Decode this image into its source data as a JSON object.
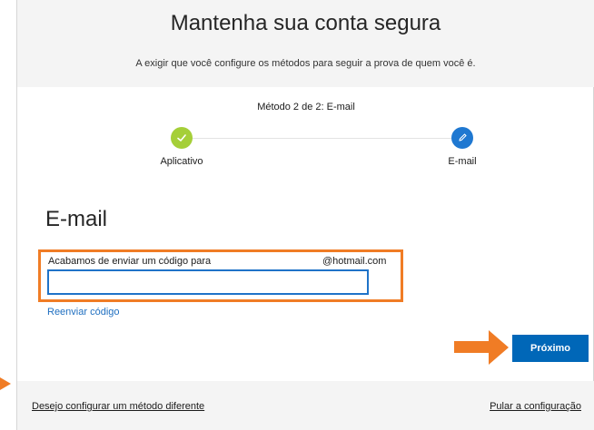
{
  "header": {
    "title": "Mantenha sua conta segura",
    "subtitle": "A exigir que você configure os métodos para seguir a prova de quem você é."
  },
  "progress": {
    "step_text": "Método 2 de 2: E-mail",
    "steps": [
      {
        "label": "Aplicativo",
        "status": "complete",
        "icon": "check-icon",
        "color": "#a5cf38"
      },
      {
        "label": "E-mail",
        "status": "current",
        "icon": "pencil-icon",
        "color": "#1f78d1"
      }
    ]
  },
  "email_section": {
    "title": "E-mail",
    "sent_label": "Acabamos de enviar um código para",
    "email": "@hotmail.com",
    "code_input": {
      "value": "",
      "placeholder": ""
    },
    "resend_label": "Reenviar código"
  },
  "actions": {
    "next_label": "Próximo"
  },
  "footer": {
    "different_method_label": "Desejo configurar um método diferente",
    "skip_label": "Pular a configuração"
  },
  "colors": {
    "accent": "#0067b8",
    "annotation": "#f07c25",
    "band": "#f4f4f4"
  }
}
